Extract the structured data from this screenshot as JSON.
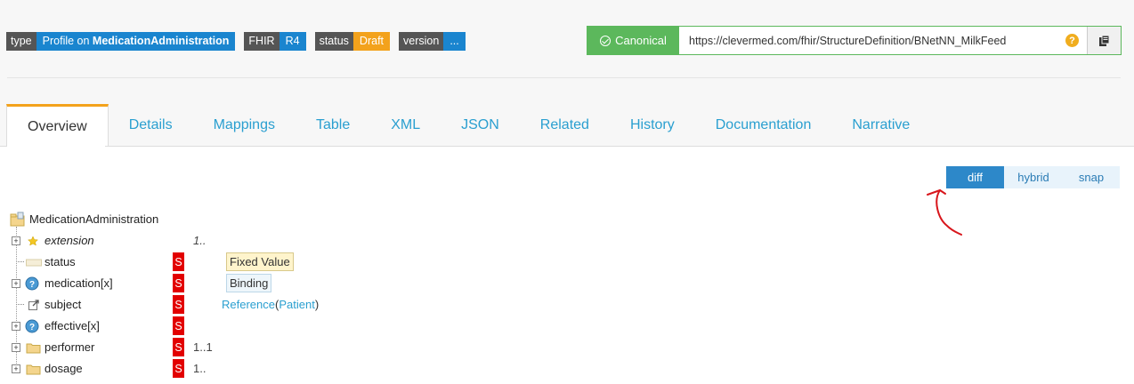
{
  "badges": [
    {
      "key": "type",
      "value_prefix": "Profile on ",
      "value_bold": "MedicationAdministration",
      "color": "#1a85cf"
    },
    {
      "key": "FHIR",
      "value": "R4",
      "color": "#1a85cf"
    },
    {
      "key": "status",
      "value": "Draft",
      "color": "#f3a21c"
    },
    {
      "key": "version",
      "value": "...",
      "color": "#1a85cf"
    }
  ],
  "canonical": {
    "label": "Canonical",
    "url": "https://clevermed.com/fhir/StructureDefinition/BNetNN_MilkFeed",
    "help_glyph": "?"
  },
  "tabs": [
    {
      "label": "Overview",
      "active": true
    },
    {
      "label": "Details"
    },
    {
      "label": "Mappings"
    },
    {
      "label": "Table"
    },
    {
      "label": "XML"
    },
    {
      "label": "JSON"
    },
    {
      "label": "Related"
    },
    {
      "label": "History"
    },
    {
      "label": "Documentation"
    },
    {
      "label": "Narrative"
    }
  ],
  "view_toggle": {
    "diff": "diff",
    "hybrid": "hybrid",
    "snap": "snap",
    "selected": "diff"
  },
  "tree": {
    "root": "MedicationAdministration",
    "elements": [
      {
        "name": "extension",
        "card": "1..",
        "flag": "",
        "extra": "",
        "icon": "star-icon"
      },
      {
        "name": "status",
        "card": "",
        "flag": "S",
        "extra": "Fixed Value",
        "icon": "primitive-icon"
      },
      {
        "name": "medication[x]",
        "card": "",
        "flag": "S",
        "extra": "Binding",
        "icon": "choice-icon"
      },
      {
        "name": "subject",
        "card": "",
        "flag": "S",
        "ref_name": "Reference",
        "ref_open": "(",
        "ref_target": "Patient",
        "ref_close": ")",
        "icon": "reference-icon"
      },
      {
        "name": "effective[x]",
        "card": "",
        "flag": "S",
        "extra": "",
        "icon": "choice-icon"
      },
      {
        "name": "performer",
        "card": "1..1",
        "flag": "S",
        "extra": "",
        "icon": "folder-icon"
      },
      {
        "name": "dosage",
        "card": "1..",
        "flag": "S",
        "extra": "",
        "icon": "folder-icon"
      }
    ]
  },
  "colors": {
    "accent": "#2a9fd0",
    "active_tab": "#f3a21c",
    "flag_red": "#e20000",
    "canonical_green": "#5cb85c"
  }
}
